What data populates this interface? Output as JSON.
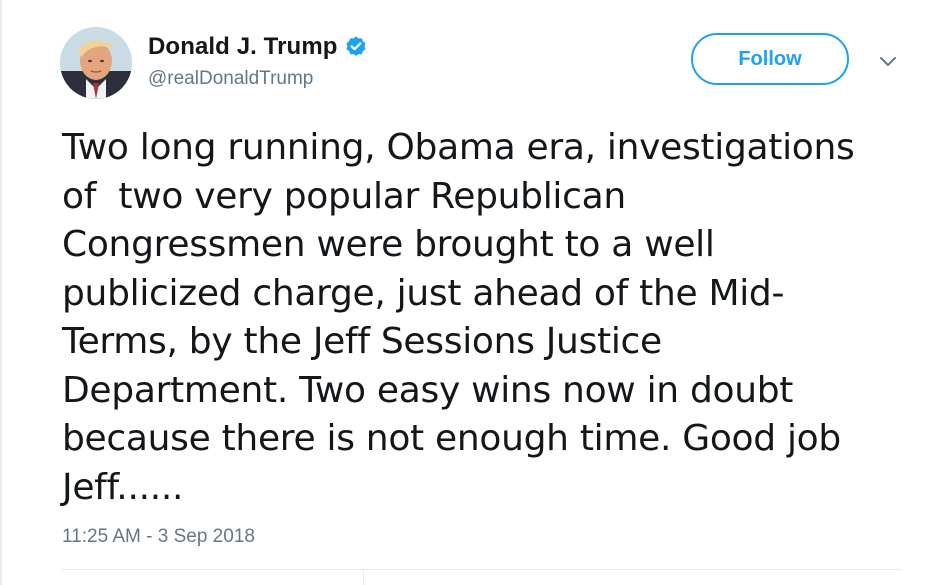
{
  "user": {
    "display_name": "Donald J. Trump",
    "handle": "@realDonaldTrump",
    "verified": true
  },
  "actions": {
    "follow_label": "Follow"
  },
  "tweet": {
    "lines": [
      "Two long running, Obama era, investigations",
      "of  two very popular Republican",
      "Congressmen were brought to a well",
      "publicized charge, just ahead of the Mid-",
      "Terms, by the Jeff Sessions Justice",
      "Department. Two easy wins now in doubt",
      "because there is not enough time. Good job",
      "Jeff......"
    ],
    "timestamp": "11:25 AM - 3 Sep 2018"
  },
  "icons": {
    "verified": "verified-badge-icon",
    "caret": "chevron-down-icon"
  },
  "colors": {
    "accent": "#1da1f2",
    "text": "#14171a",
    "muted": "#657786",
    "divider": "#e6ecf0"
  }
}
